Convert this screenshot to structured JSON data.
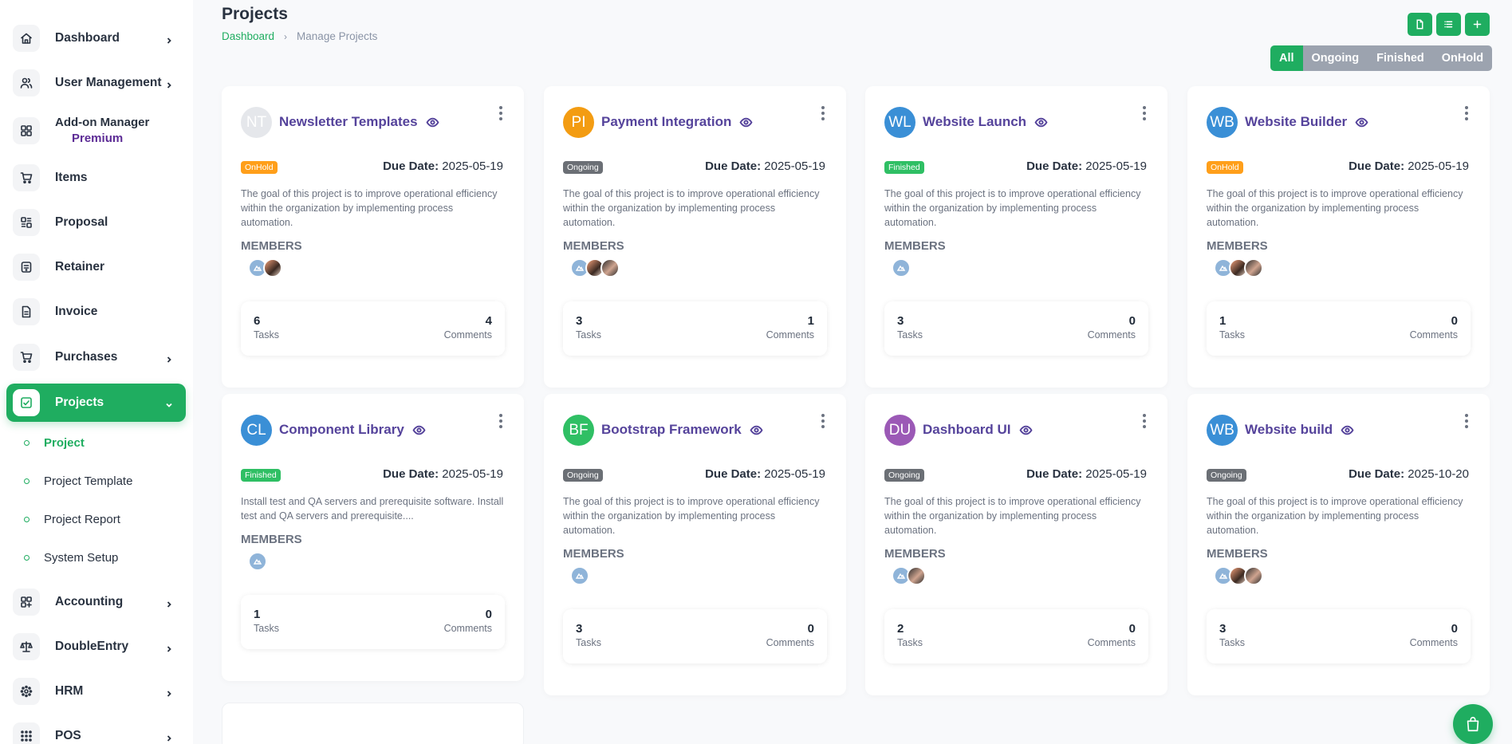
{
  "sidebar": {
    "items": [
      {
        "label": "Dashboard",
        "icon": "home-icon",
        "chevron": true
      },
      {
        "label": "User Management",
        "icon": "users-icon",
        "chevron": true
      },
      {
        "label": "Add-on Manager",
        "sublabel": "Premium",
        "icon": "grid-icon",
        "chevron": false
      },
      {
        "label": "Items",
        "icon": "cart-icon",
        "chevron": false
      },
      {
        "label": "Proposal",
        "icon": "proposal-icon",
        "chevron": false
      },
      {
        "label": "Retainer",
        "icon": "retainer-icon",
        "chevron": false
      },
      {
        "label": "Invoice",
        "icon": "invoice-icon",
        "chevron": false
      },
      {
        "label": "Purchases",
        "icon": "cart-icon",
        "chevron": true
      },
      {
        "label": "Projects",
        "icon": "checklist-icon",
        "chevron": true,
        "active": true
      },
      {
        "label": "Accounting",
        "icon": "accounting-icon",
        "chevron": true
      },
      {
        "label": "DoubleEntry",
        "icon": "scale-icon",
        "chevron": true
      },
      {
        "label": "HRM",
        "icon": "hrm-icon",
        "chevron": true
      },
      {
        "label": "POS",
        "icon": "pos-icon",
        "chevron": true
      }
    ],
    "subitems": [
      {
        "label": "Project",
        "active": true
      },
      {
        "label": "Project Template"
      },
      {
        "label": "Project Report"
      },
      {
        "label": "System Setup"
      }
    ]
  },
  "header": {
    "title": "Projects",
    "breadcrumb_home": "Dashboard",
    "breadcrumb_current": "Manage Projects"
  },
  "filters": [
    "All",
    "Ongoing",
    "Finished",
    "OnHold"
  ],
  "labels": {
    "due_date": "Due Date:",
    "members": "MEMBERS",
    "tasks": "Tasks",
    "comments": "Comments"
  },
  "projects": [
    {
      "initials": "NT",
      "title": "Newsletter Templates",
      "status": "OnHold",
      "due": "2025-05-19",
      "desc": "The goal of this project is to improve operational efficiency within the organization by implementing process automation.",
      "members": [
        "a",
        "b"
      ],
      "tasks": "6",
      "comments": "4",
      "avatar_color": "#e5e7eb"
    },
    {
      "initials": "PI",
      "title": "Payment Integration",
      "status": "Ongoing",
      "due": "2025-05-19",
      "desc": "The goal of this project is to improve operational efficiency within the organization by implementing process automation.",
      "members": [
        "a",
        "b",
        "c"
      ],
      "tasks": "3",
      "comments": "1",
      "avatar_color": "#f39c12"
    },
    {
      "initials": "WL",
      "title": "Website Launch",
      "status": "Finished",
      "due": "2025-05-19",
      "desc": "The goal of this project is to improve operational efficiency within the organization by implementing process automation.",
      "members": [
        "a"
      ],
      "tasks": "3",
      "comments": "0",
      "avatar_color": "#3a8fd6"
    },
    {
      "initials": "WB",
      "title": "Website Builder",
      "status": "OnHold",
      "due": "2025-05-19",
      "desc": "The goal of this project is to improve operational efficiency within the organization by implementing process automation.",
      "members": [
        "a",
        "b",
        "c"
      ],
      "tasks": "1",
      "comments": "0",
      "avatar_color": "#3a8fd6"
    },
    {
      "initials": "CL",
      "title": "Component Library",
      "status": "Finished",
      "due": "2025-05-19",
      "desc": "Install test and QA servers and prerequisite software. Install test and QA servers and prerequisite....",
      "members": [
        "a"
      ],
      "tasks": "1",
      "comments": "0",
      "avatar_color": "#3a8fd6"
    },
    {
      "initials": "BF",
      "title": "Bootstrap Framework",
      "status": "Ongoing",
      "due": "2025-05-19",
      "desc": "The goal of this project is to improve operational efficiency within the organization by implementing process automation.",
      "members": [
        "a"
      ],
      "tasks": "3",
      "comments": "0",
      "avatar_color": "#2fbf64"
    },
    {
      "initials": "DU",
      "title": "Dashboard UI",
      "status": "Ongoing",
      "due": "2025-05-19",
      "desc": "The goal of this project is to improve operational efficiency within the organization by implementing process automation.",
      "members": [
        "a",
        "c"
      ],
      "tasks": "2",
      "comments": "0",
      "avatar_color": "#9b59b6"
    },
    {
      "initials": "WB",
      "title": "Website build",
      "status": "Ongoing",
      "due": "2025-10-20",
      "desc": "The goal of this project is to improve operational efficiency within the organization by implementing process automation.",
      "members": [
        "a",
        "b",
        "c"
      ],
      "tasks": "3",
      "comments": "0",
      "avatar_color": "#3a8fd6"
    }
  ],
  "colors": {
    "accent": "#1fad60",
    "title_purple": "#55439b",
    "onhold": "#ff9f1a",
    "ongoing": "#6b6f75",
    "finished": "#2fbf64"
  }
}
